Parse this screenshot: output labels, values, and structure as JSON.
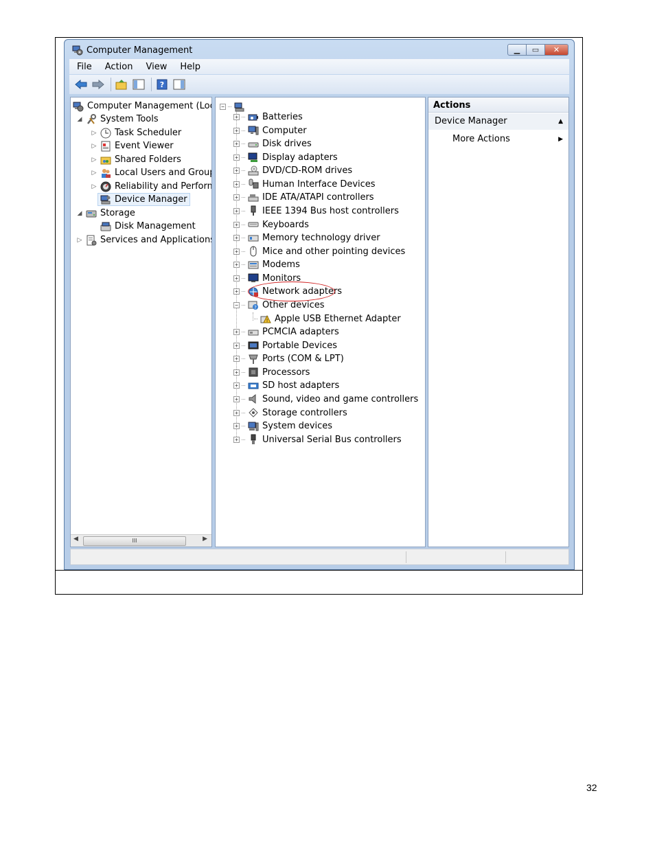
{
  "window": {
    "title": "Computer Management"
  },
  "menu": [
    "File",
    "Action",
    "View",
    "Help"
  ],
  "toolbar": [
    {
      "icon": "back-arrow-icon"
    },
    {
      "icon": "forward-arrow-icon"
    },
    {
      "icon": "up-folder-icon"
    },
    {
      "icon": "show-hide-console-tree-icon"
    },
    {
      "icon": "help-icon"
    },
    {
      "icon": "show-hide-action-pane-icon"
    }
  ],
  "tree": {
    "root": "Computer Management (Local",
    "system_tools": "System Tools",
    "task_scheduler": "Task Scheduler",
    "event_viewer": "Event Viewer",
    "shared_folders": "Shared Folders",
    "local_users": "Local Users and Groups",
    "reliability": "Reliability and Performa",
    "device_manager": "Device Manager",
    "storage": "Storage",
    "disk_management": "Disk Management",
    "services": "Services and Applications",
    "scroll_grip": "III"
  },
  "devices": [
    "Batteries",
    "Computer",
    "Disk drives",
    "Display adapters",
    "DVD/CD-ROM drives",
    "Human Interface Devices",
    "IDE ATA/ATAPI controllers",
    "IEEE 1394 Bus host controllers",
    "Keyboards",
    "Memory technology driver",
    "Mice and other pointing devices",
    "Modems",
    "Monitors",
    "Network adapters",
    "Other devices",
    "Apple USB Ethernet Adapter",
    "PCMCIA adapters",
    "Portable Devices",
    "Ports (COM & LPT)",
    "Processors",
    "SD host adapters",
    "Sound, video and game controllers",
    "Storage controllers",
    "System devices",
    "Universal Serial Bus controllers"
  ],
  "actions": {
    "header": "Actions",
    "section": "Device Manager",
    "more": "More Actions"
  },
  "page": {
    "number": "32"
  }
}
